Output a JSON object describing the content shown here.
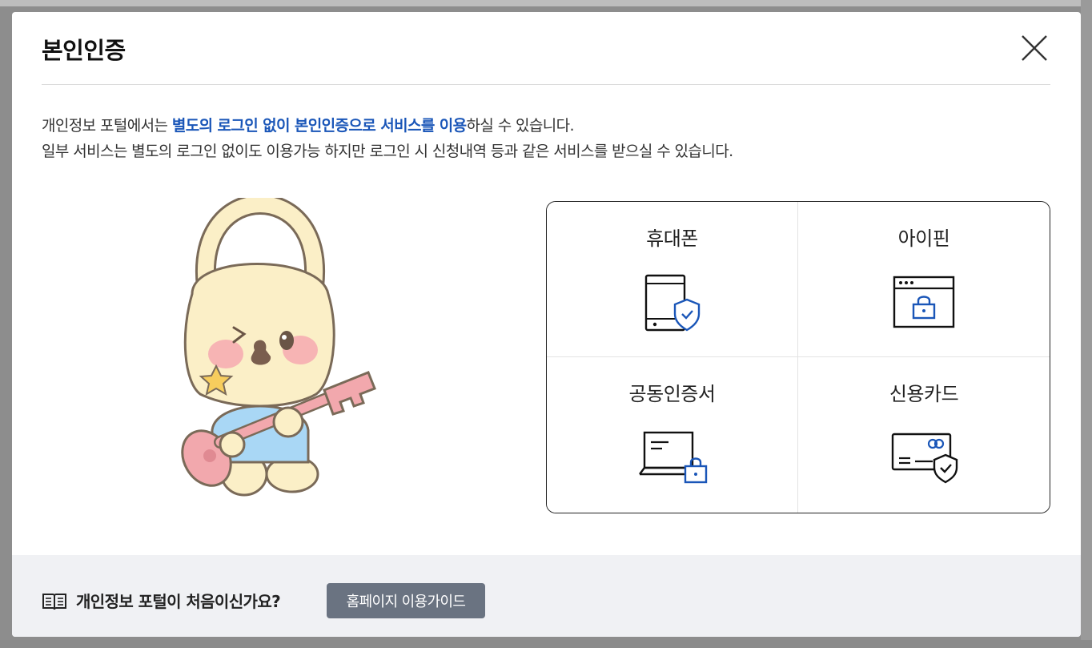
{
  "modal": {
    "title": "본인인증",
    "intro_line1_part1": "개인정보 포털에서는 ",
    "intro_line1_highlight": "별도의 로그인 없이 본인인증으로 서비스를 이용",
    "intro_line1_part2": "하실 수 있습니다.",
    "intro_line2": "일부 서비스는 별도의 로그인 없이도 이용가능 하지만 로그인 시 신청내역 등과 같은 서비스를 받으실 수 있습니다."
  },
  "auth_options": [
    {
      "label": "휴대폰",
      "icon": "phone-shield-icon"
    },
    {
      "label": "아이핀",
      "icon": "browser-lock-icon"
    },
    {
      "label": "공동인증서",
      "icon": "laptop-lock-icon"
    },
    {
      "label": "신용카드",
      "icon": "card-shield-icon"
    }
  ],
  "footer": {
    "question": "개인정보 포털이 처음이신가요?",
    "guide_button": "홈페이지 이용가이드",
    "icon": "book-icon"
  },
  "colors": {
    "accent": "#1a56b8",
    "button_bg": "#6a7381",
    "footer_bg": "#f0f1f4"
  }
}
